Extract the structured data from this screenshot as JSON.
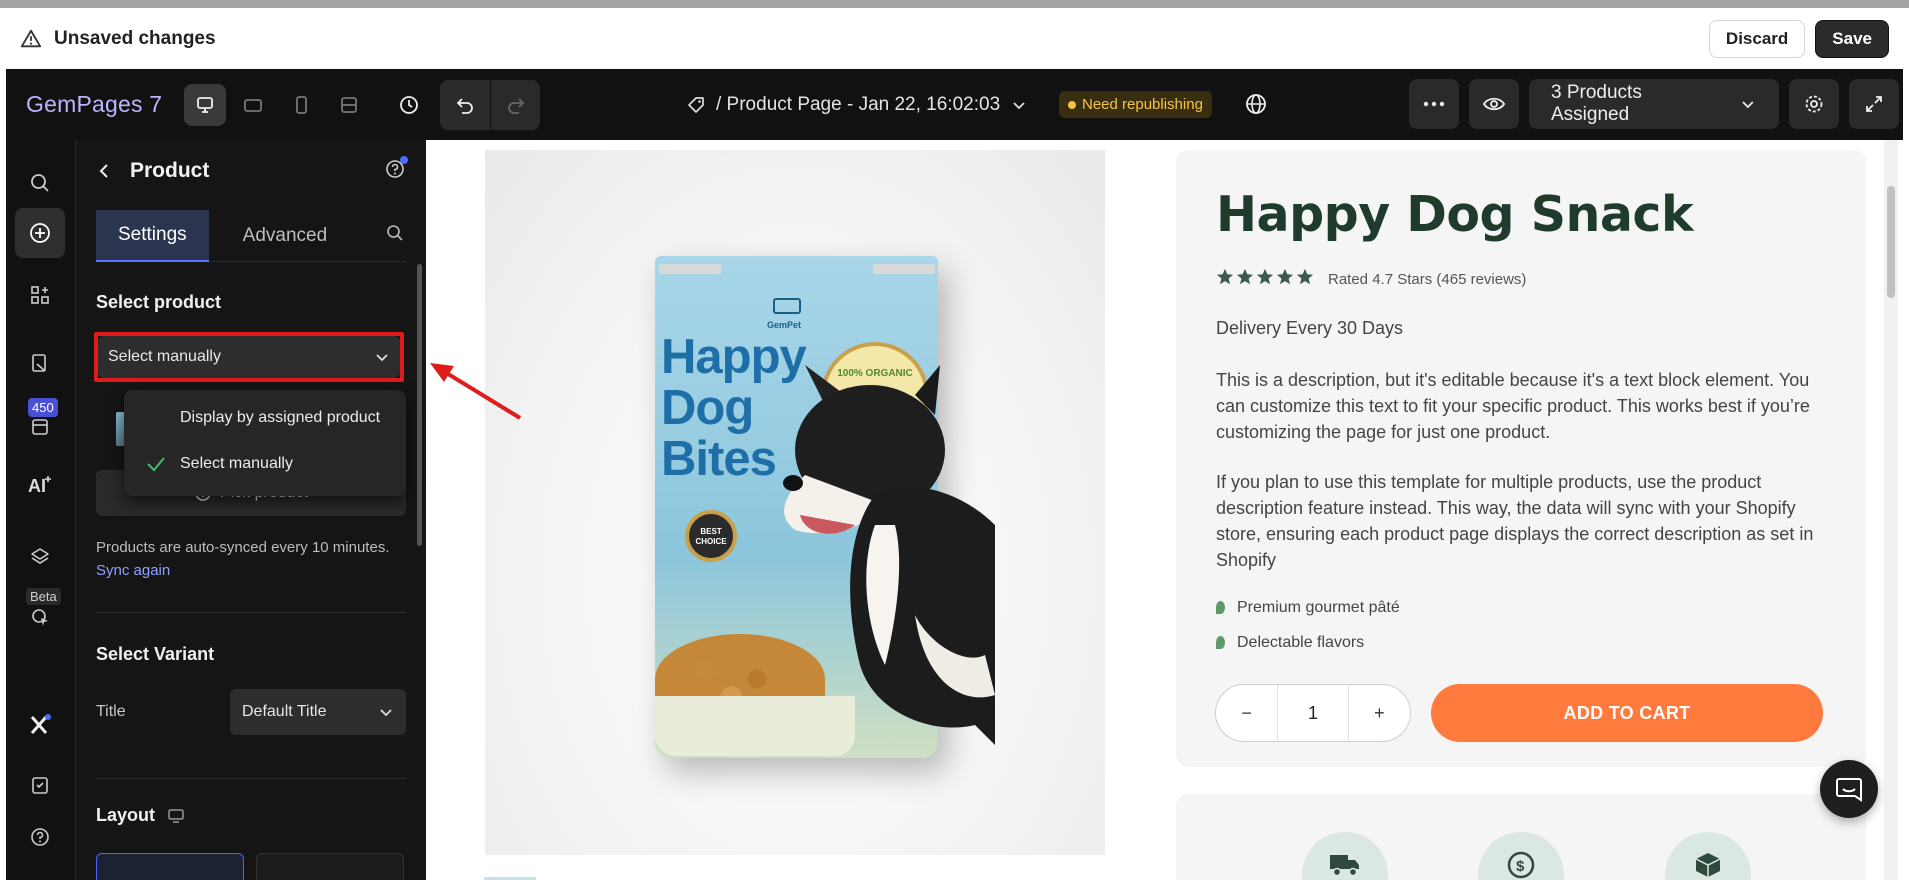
{
  "unsaved_bar": {
    "message": "Unsaved changes",
    "discard_label": "Discard",
    "save_label": "Save"
  },
  "toolbar": {
    "logo": "GemPages 7",
    "page_title": "/ Product Page - Jan 22, 16:02:03",
    "status_badge": "Need republishing",
    "assigned_label": "3 Products Assigned"
  },
  "rail": {
    "count_badge": "450",
    "beta_label": "Beta"
  },
  "panel": {
    "title": "Product",
    "tabs": [
      "Settings",
      "Advanced"
    ],
    "select_product_heading": "Select product",
    "select_value": "Select manually",
    "dropdown_options": [
      {
        "label": "Display by assigned product",
        "selected": false
      },
      {
        "label": "Select manually",
        "selected": true
      }
    ],
    "pick_product_label": "Pick product",
    "sync_note": "Products are auto-synced every 10 minutes.",
    "sync_link": "Sync again",
    "select_variant_heading": "Select Variant",
    "variant_label": "Title",
    "variant_value": "Default Title",
    "layout_heading": "Layout"
  },
  "product": {
    "bag_text": "Happy Dog Bites",
    "bag_brand": "GemPet",
    "bag_seal": "100% ORGANIC",
    "bag_badge": "BEST CHOICE",
    "title": "Happy Dog Snack",
    "rating_text": "Rated 4.7 Stars (465 reviews)",
    "rating_value": 4.7,
    "delivery": "Delivery Every 30 Days",
    "description_1": "This is a description, but it's editable because it's a text block element. You can customize this text to fit your specific product. This works best if you’re customizing the page for just one product.",
    "description_2": "If you plan to use this template for multiple products, use the product description feature instead. This way, the data will sync with your Shopify store, ensuring each product page displays the correct description as set in Shopify",
    "bullets": [
      "Premium gourmet pâté",
      "Delectable flavors"
    ],
    "qty_minus": "−",
    "qty_value": "1",
    "qty_plus": "+",
    "add_to_cart": "ADD TO CART"
  },
  "colors": {
    "accent_orange": "#ff7a3d",
    "highlight_red": "#e01b1b",
    "title_green": "#1f3b2c",
    "badge_yellow": "#f6c343",
    "tab_blue": "#5b73ff"
  }
}
